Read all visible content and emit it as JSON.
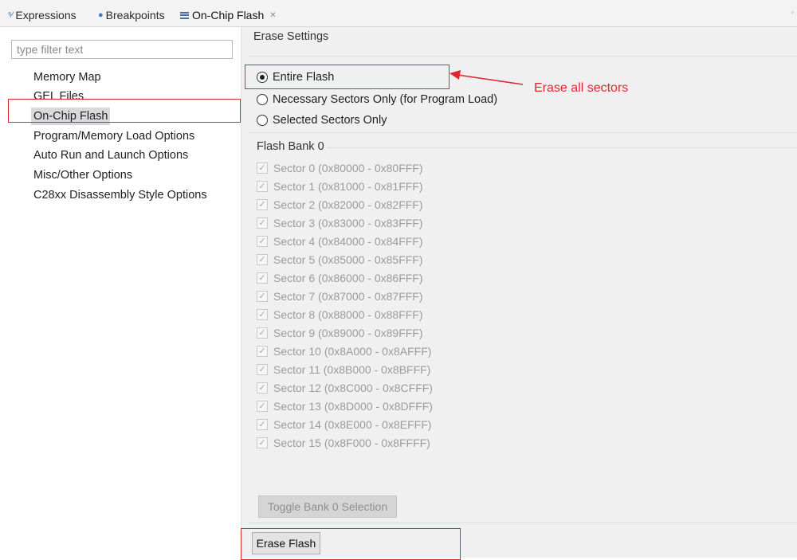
{
  "tabs": [
    {
      "label": "Expressions",
      "icon": "expressions-icon"
    },
    {
      "label": "Breakpoints",
      "icon": "breakpoints-icon"
    },
    {
      "label": "On-Chip Flash",
      "icon": "memory-view-icon",
      "close": "✕",
      "active": true
    }
  ],
  "filter": {
    "placeholder": "type filter text",
    "value": ""
  },
  "nav": {
    "items": [
      {
        "label": "Memory Map"
      },
      {
        "label": "GEL Files"
      },
      {
        "label": "On-Chip Flash",
        "selected": true
      },
      {
        "label": "Program/Memory Load Options"
      },
      {
        "label": "Auto Run and Launch Options"
      },
      {
        "label": "Misc/Other Options"
      },
      {
        "label": "C28xx Disassembly Style Options"
      }
    ]
  },
  "erase_settings": {
    "title": "Erase Settings",
    "options": [
      {
        "label": "Entire Flash",
        "checked": true
      },
      {
        "label": "Necessary Sectors Only (for Program Load)",
        "checked": false
      },
      {
        "label": "Selected Sectors Only",
        "checked": false
      }
    ]
  },
  "flash_bank": {
    "title": "Flash Bank 0",
    "sectors": [
      {
        "label": "Sector 0 (0x80000 - 0x80FFF)",
        "checked": true,
        "enabled": false
      },
      {
        "label": "Sector 1 (0x81000 - 0x81FFF)",
        "checked": true,
        "enabled": false
      },
      {
        "label": "Sector 2 (0x82000 - 0x82FFF)",
        "checked": true,
        "enabled": false
      },
      {
        "label": "Sector 3 (0x83000 - 0x83FFF)",
        "checked": true,
        "enabled": false
      },
      {
        "label": "Sector 4 (0x84000 - 0x84FFF)",
        "checked": true,
        "enabled": false
      },
      {
        "label": "Sector 5 (0x85000 - 0x85FFF)",
        "checked": true,
        "enabled": false
      },
      {
        "label": "Sector 6 (0x86000 - 0x86FFF)",
        "checked": true,
        "enabled": false
      },
      {
        "label": "Sector 7 (0x87000 - 0x87FFF)",
        "checked": true,
        "enabled": false
      },
      {
        "label": "Sector 8 (0x88000 - 0x88FFF)",
        "checked": true,
        "enabled": false
      },
      {
        "label": "Sector 9 (0x89000 - 0x89FFF)",
        "checked": true,
        "enabled": false
      },
      {
        "label": "Sector 10 (0x8A000 - 0x8AFFF)",
        "checked": true,
        "enabled": false
      },
      {
        "label": "Sector 11 (0x8B000 - 0x8BFFF)",
        "checked": true,
        "enabled": false
      },
      {
        "label": "Sector 12 (0x8C000 - 0x8CFFF)",
        "checked": true,
        "enabled": false
      },
      {
        "label": "Sector 13 (0x8D000 - 0x8DFFF)",
        "checked": true,
        "enabled": false
      },
      {
        "label": "Sector 14 (0x8E000 - 0x8EFFF)",
        "checked": true,
        "enabled": false
      },
      {
        "label": "Sector 15 (0x8F000 - 0x8FFFF)",
        "checked": true,
        "enabled": false
      }
    ],
    "toggle_label": "Toggle Bank 0 Selection"
  },
  "erase_button_label": "Erase Flash",
  "annotation": {
    "text": "Erase all sectors",
    "color": "#e0262e"
  },
  "colors": {
    "highlight_box": "#e0262e",
    "selected_nav": "#d9d9d9",
    "disabled_text": "#9b9b9b"
  }
}
